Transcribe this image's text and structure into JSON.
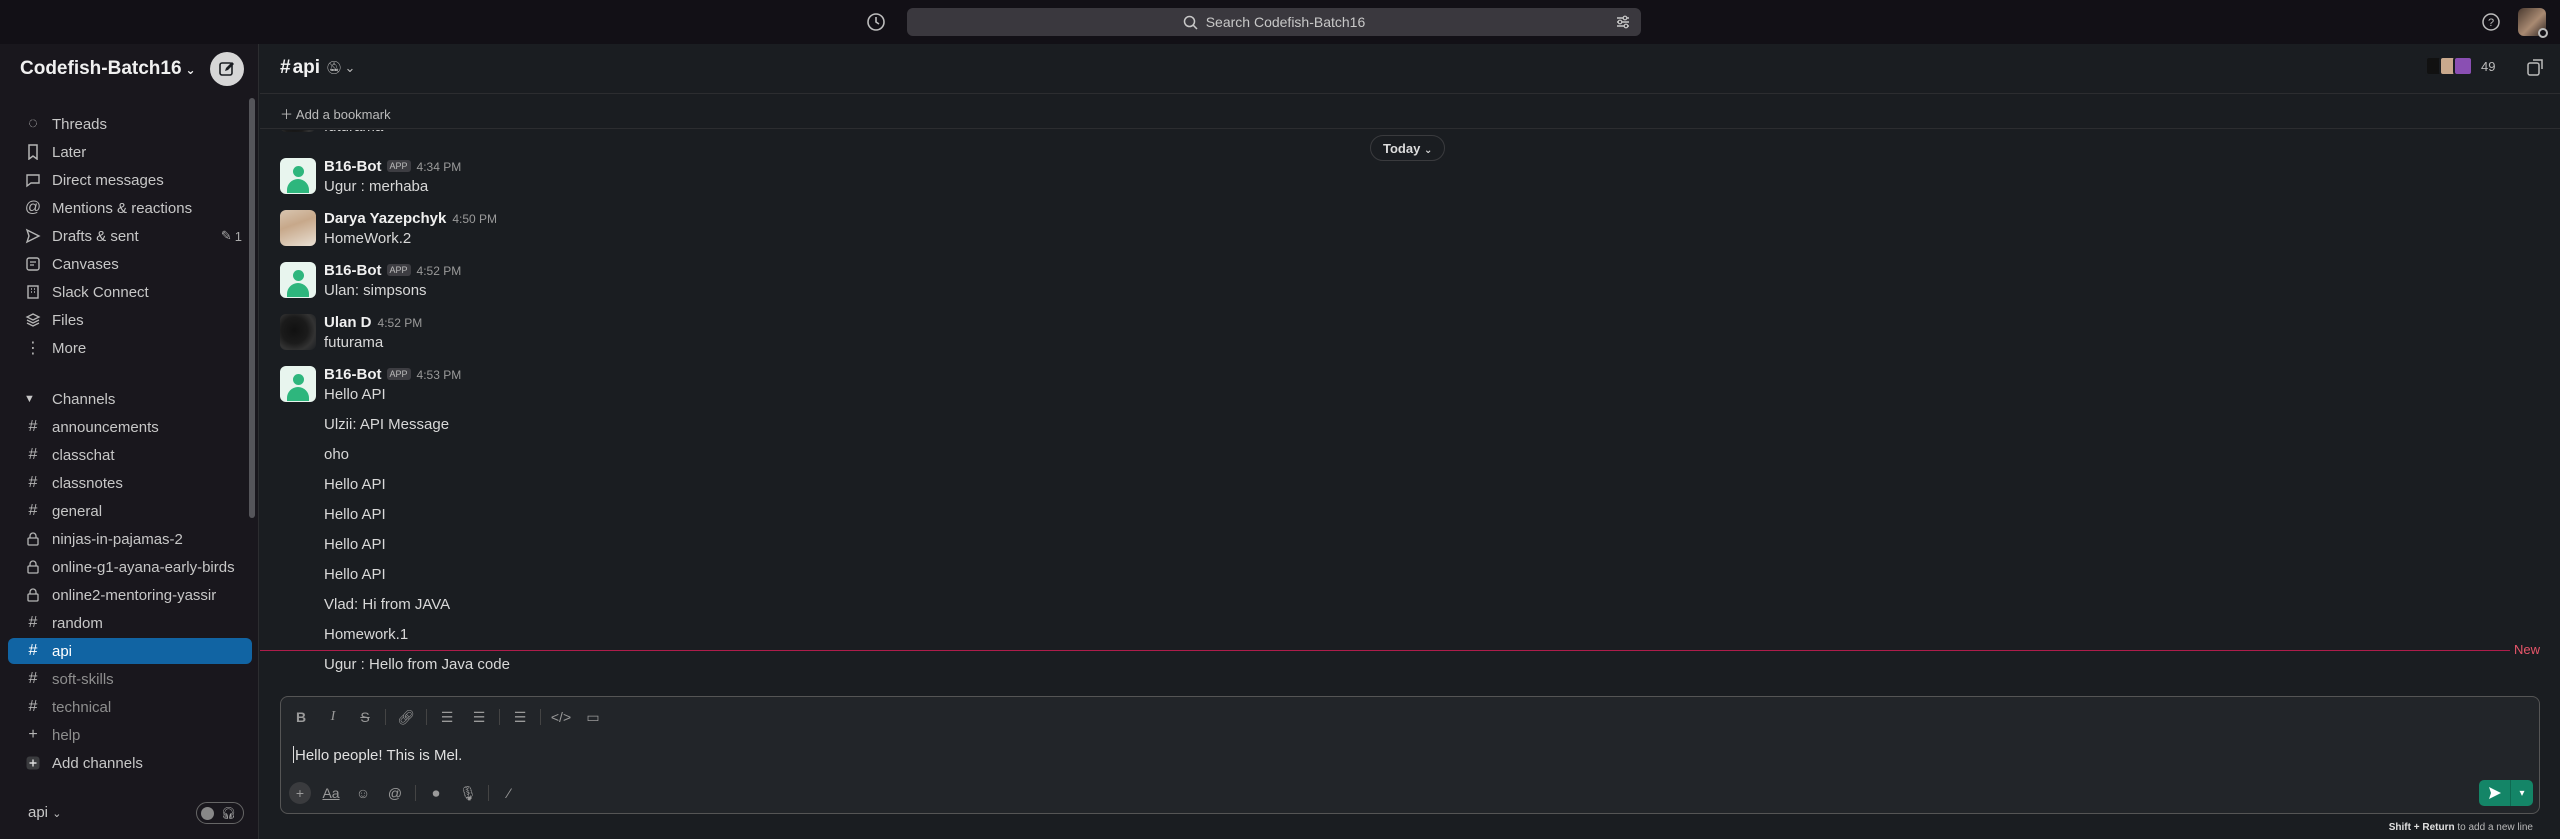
{
  "topbar": {
    "search_placeholder": "Search Codefish-Batch16"
  },
  "workspace": {
    "name": "Codefish-Batch16"
  },
  "sidebar": {
    "nav": [
      {
        "label": "Threads",
        "icon": "threads-icon"
      },
      {
        "label": "Later",
        "icon": "bookmark-icon"
      },
      {
        "label": "Direct messages",
        "icon": "dm-icon"
      },
      {
        "label": "Mentions & reactions",
        "icon": "at-icon"
      },
      {
        "label": "Drafts & sent",
        "icon": "send-icon",
        "badge": "1"
      },
      {
        "label": "Canvases",
        "icon": "canvas-icon"
      },
      {
        "label": "Slack Connect",
        "icon": "building-icon"
      },
      {
        "label": "Files",
        "icon": "layers-icon"
      },
      {
        "label": "More",
        "icon": "more-icon"
      }
    ],
    "channels_header": "Channels",
    "channels": [
      {
        "label": "announcements",
        "type": "public"
      },
      {
        "label": "classchat",
        "type": "public"
      },
      {
        "label": "classnotes",
        "type": "public"
      },
      {
        "label": "general",
        "type": "public"
      },
      {
        "label": "ninjas-in-pajamas-2",
        "type": "private"
      },
      {
        "label": "online-g1-ayana-early-birds",
        "type": "private"
      },
      {
        "label": "online2-mentoring-yassir",
        "type": "private"
      },
      {
        "label": "random",
        "type": "public"
      },
      {
        "label": "api",
        "type": "public",
        "active": true
      },
      {
        "label": "soft-skills",
        "type": "public",
        "dim": true
      },
      {
        "label": "technical",
        "type": "public",
        "dim": true
      },
      {
        "label": "help",
        "type": "add",
        "dim": true
      }
    ],
    "add_channels": "Add channels",
    "footer_channel": "api"
  },
  "channel": {
    "name": "api",
    "member_count": "49",
    "bookmark": "Add a bookmark",
    "date_divider": "Today"
  },
  "messages": {
    "top_partial": "futurama",
    "m1": {
      "author": "B16-Bot",
      "app": "APP",
      "time": "4:34 PM",
      "text": "Ugur : merhaba"
    },
    "m2": {
      "author": "Darya Yazepchyk",
      "time": "4:50 PM",
      "text": "HomeWork.2"
    },
    "m3": {
      "author": "B16-Bot",
      "app": "APP",
      "time": "4:52 PM",
      "text": "Ulan: simpsons"
    },
    "m4": {
      "author": "Ulan D",
      "time": "4:52 PM",
      "text": "futurama"
    },
    "m5": {
      "author": "B16-Bot",
      "app": "APP",
      "time": "4:53 PM",
      "lines": [
        "Hello API",
        "Ulzii: API Message",
        "oho",
        "Hello API",
        "Hello API",
        "Hello API",
        "Hello API",
        "Vlad: Hi from JAVA",
        "Homework.1",
        "Ugur : Hello from Java code"
      ]
    },
    "new_label": "New"
  },
  "composer": {
    "value": "Hello people! This is Mel.",
    "hint_keys": "Shift + Return",
    "hint_text": "to add a new line"
  },
  "colors": {
    "accent": "#1164a3",
    "send": "#148567",
    "new_line": "#e01e5a",
    "bot": "#2eb67d"
  }
}
